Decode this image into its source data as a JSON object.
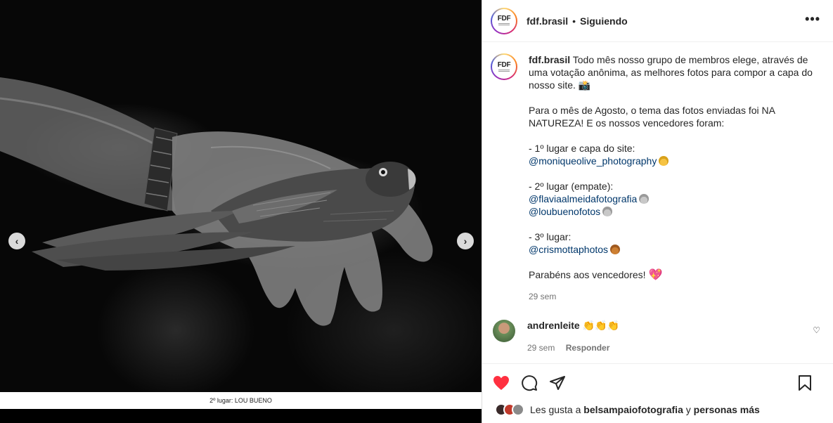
{
  "post": {
    "username": "fdf.brasil",
    "separator": "•",
    "follow_status": "Siguiendo",
    "more": "•••",
    "logo_text": "FDF"
  },
  "media": {
    "overlay_caption": "2º lugar: LOU BUENO",
    "prev": "‹",
    "next": "›"
  },
  "caption": {
    "username": "fdf.brasil",
    "intro": "Todo mês nosso grupo de membros elege, através de uma votação anônima, as melhores fotos para compor a capa do nosso site. 📸",
    "theme": "Para o mês de Agosto, o tema das fotos enviadas foi NA NATUREZA! E os nossos vencedores foram:",
    "first_label": "- 1º lugar e capa do site:",
    "first_mention": "@moniqueolive_photography",
    "second_label": "- 2º lugar (empate):",
    "second_mention_1": "@flaviaalmeidafotografia",
    "second_mention_2": "@loubuenofotos",
    "third_label": "- 3º lugar:",
    "third_mention": "@crismottaphotos",
    "closing": "Parabéns aos vencedores!",
    "closing_emoji": "💖",
    "time": "29 sem"
  },
  "comment": {
    "username": "andrenleite",
    "text": "👏👏👏",
    "time": "29 sem",
    "reply": "Responder",
    "like_icon": "♡"
  },
  "likes": {
    "prefix": "Les gusta a",
    "user": "belsampaiofotografia",
    "middle": "y",
    "suffix": "personas más"
  },
  "colors": {
    "like_red": "#ff3040",
    "mention_blue": "#00376b",
    "muted_gray": "#737373"
  }
}
